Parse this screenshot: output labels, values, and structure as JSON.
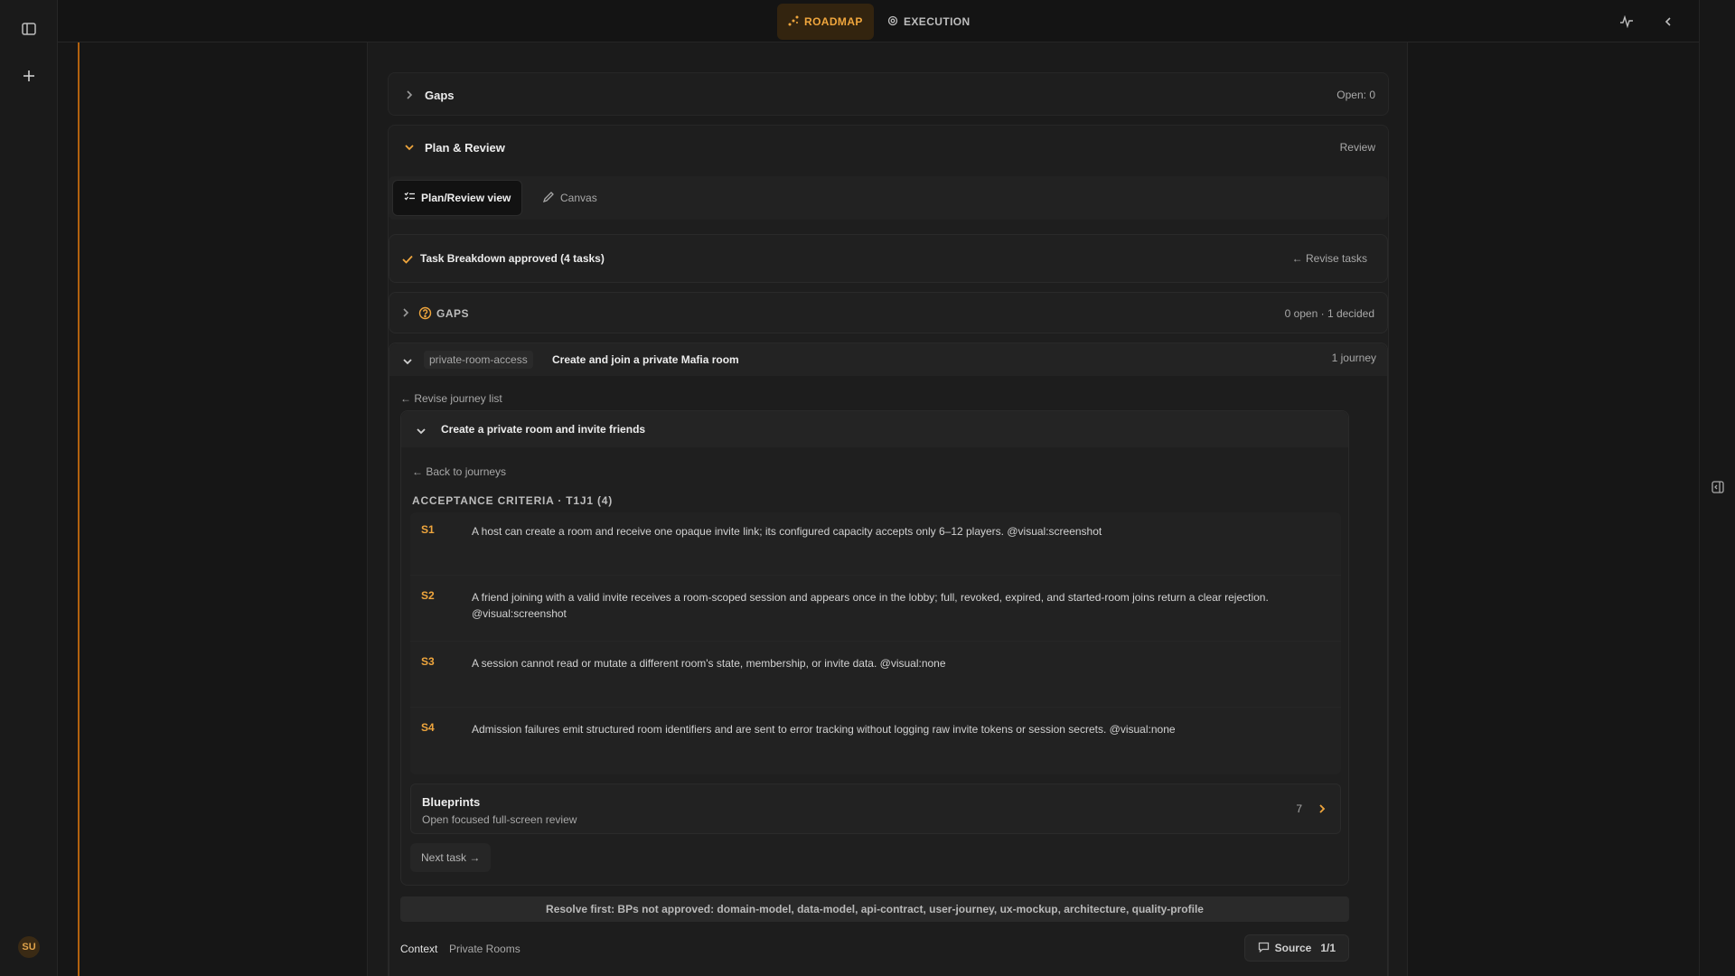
{
  "modes": {
    "roadmap": "ROADMAP",
    "execution": "EXECUTION"
  },
  "user": {
    "initials": "SU"
  },
  "gaps_section": {
    "title": "Gaps",
    "meta": "Open: 0"
  },
  "plan_section": {
    "title": "Plan & Review",
    "meta": "Review"
  },
  "view_toggle": {
    "plan_review": "Plan/Review view",
    "canvas": "Canvas"
  },
  "task_breakdown": {
    "text": "Task Breakdown approved (4 tasks)",
    "revise": "← Revise tasks"
  },
  "gaps_inner": {
    "title": "GAPS",
    "meta": "0 open · 1 decided"
  },
  "feature": {
    "slug": "private-room-access",
    "title": "Create and join a private Mafia room",
    "meta": "1 journey",
    "revise_list": "← Revise journey list"
  },
  "journey": {
    "title": "Create a private room and invite friends",
    "back": "← Back to journeys",
    "criteria_heading": "ACCEPTANCE CRITERIA · T1J1 (4)",
    "criteria": [
      {
        "id": "S1",
        "text": "A host can create a room and receive one opaque invite link; its configured capacity accepts only 6–12 players. @visual:screenshot"
      },
      {
        "id": "S2",
        "text": "A friend joining with a valid invite receives a room-scoped session and appears once in the lobby; full, revoked, expired, and started-room joins return a clear rejection. @visual:screenshot"
      },
      {
        "id": "S3",
        "text": "A session cannot read or mutate a different room's state, membership, or invite data. @visual:none"
      },
      {
        "id": "S4",
        "text": "Admission failures emit structured room identifiers and are sent to error tracking without logging raw invite tokens or session secrets. @visual:none"
      }
    ],
    "blueprints": {
      "title": "Blueprints",
      "subtitle": "Open focused full-screen review",
      "count": "7"
    },
    "next_task": "Next task →"
  },
  "resolve_note": "Resolve first: BPs not approved: domain-model, data-model, api-contract, user-journey, ux-mockup, architecture, quality-profile",
  "footer": {
    "context_label": "Context",
    "context_value": "Private Rooms",
    "source": "Source",
    "source_count": "1/1"
  },
  "colors": {
    "accent": "#f0a63d",
    "background": "#161616"
  }
}
